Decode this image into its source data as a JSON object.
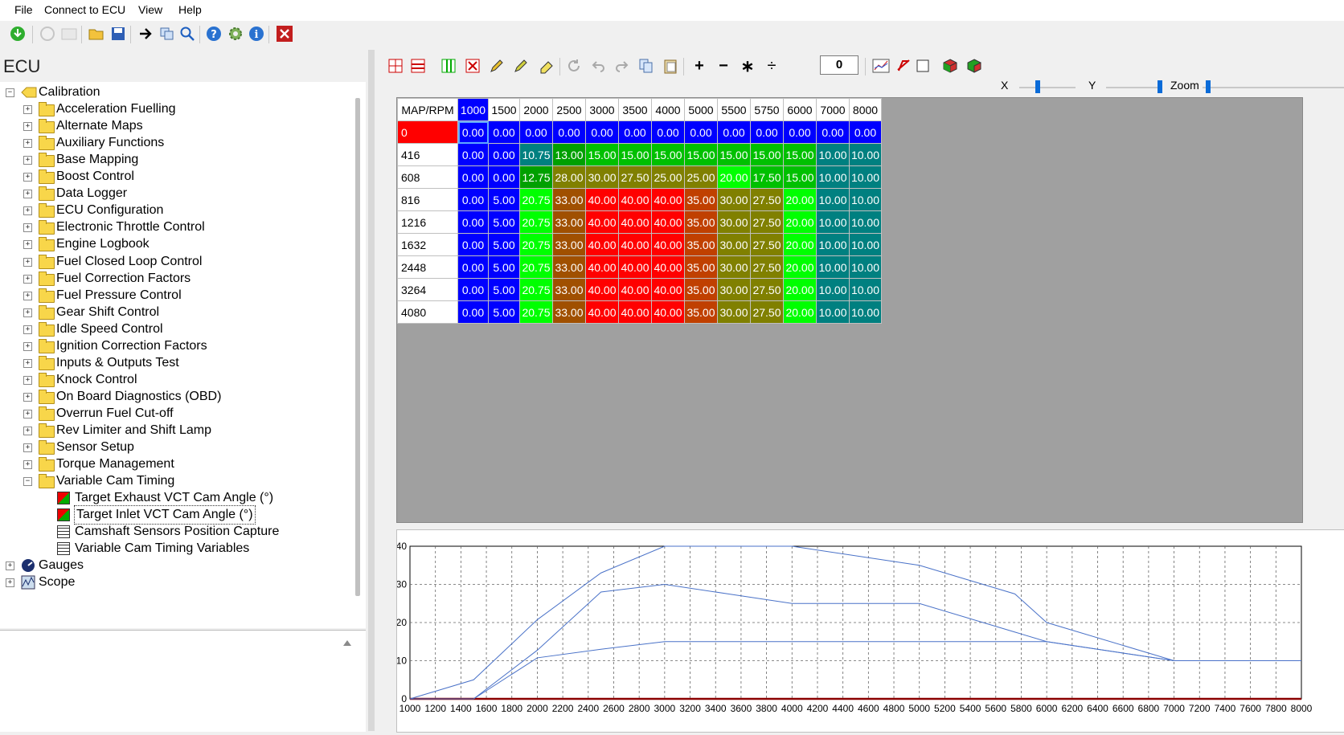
{
  "menu": [
    "File",
    "Connect to ECU",
    "View",
    "Help"
  ],
  "left": {
    "title": "ECU",
    "tree": [
      {
        "label": "Calibration",
        "level": 0,
        "icon": "calibration-icon",
        "expanded": true
      },
      {
        "label": "Acceleration Fuelling",
        "level": 1,
        "icon": "folder-icon"
      },
      {
        "label": "Alternate Maps",
        "level": 1,
        "icon": "folder-icon"
      },
      {
        "label": "Auxiliary Functions",
        "level": 1,
        "icon": "folder-icon"
      },
      {
        "label": "Base Mapping",
        "level": 1,
        "icon": "folder-icon"
      },
      {
        "label": "Boost Control",
        "level": 1,
        "icon": "folder-icon"
      },
      {
        "label": "Data Logger",
        "level": 1,
        "icon": "folder-icon"
      },
      {
        "label": "ECU Configuration",
        "level": 1,
        "icon": "folder-icon"
      },
      {
        "label": "Electronic Throttle Control",
        "level": 1,
        "icon": "folder-icon"
      },
      {
        "label": "Engine Logbook",
        "level": 1,
        "icon": "folder-icon"
      },
      {
        "label": "Fuel Closed Loop Control",
        "level": 1,
        "icon": "folder-icon"
      },
      {
        "label": "Fuel Correction Factors",
        "level": 1,
        "icon": "folder-icon"
      },
      {
        "label": "Fuel Pressure Control",
        "level": 1,
        "icon": "folder-icon"
      },
      {
        "label": "Gear Shift Control",
        "level": 1,
        "icon": "folder-icon"
      },
      {
        "label": "Idle Speed Control",
        "level": 1,
        "icon": "folder-icon"
      },
      {
        "label": "Ignition Correction Factors",
        "level": 1,
        "icon": "folder-icon"
      },
      {
        "label": "Inputs & Outputs Test",
        "level": 1,
        "icon": "folder-icon"
      },
      {
        "label": "Knock Control",
        "level": 1,
        "icon": "folder-icon"
      },
      {
        "label": "On Board Diagnostics (OBD)",
        "level": 1,
        "icon": "folder-icon"
      },
      {
        "label": "Overrun Fuel Cut-off",
        "level": 1,
        "icon": "folder-icon"
      },
      {
        "label": "Rev Limiter and Shift Lamp",
        "level": 1,
        "icon": "folder-icon"
      },
      {
        "label": "Sensor Setup",
        "level": 1,
        "icon": "folder-icon"
      },
      {
        "label": "Torque Management",
        "level": 1,
        "icon": "folder-icon"
      },
      {
        "label": "Variable Cam Timing",
        "level": 1,
        "icon": "folder-icon",
        "expanded": true
      },
      {
        "label": "Target Exhaust VCT Cam Angle (°)",
        "level": 2,
        "icon": "map-cube-icon"
      },
      {
        "label": "Target Inlet VCT Cam Angle (°)",
        "level": 2,
        "icon": "map-cube-icon",
        "selected": true
      },
      {
        "label": "Camshaft Sensors Position Capture",
        "level": 2,
        "icon": "grid-icon"
      },
      {
        "label": "Variable Cam Timing Variables",
        "level": 2,
        "icon": "grid-icon"
      },
      {
        "label": "Gauges",
        "level": 0,
        "icon": "gauges-icon"
      },
      {
        "label": "Scope",
        "level": 0,
        "icon": "scope-icon"
      }
    ]
  },
  "toolbar_value": "0",
  "sliders": {
    "x": "X",
    "y": "Y",
    "zoom": "Zoom"
  },
  "table": {
    "corner": "MAP/RPM",
    "columns": [
      "1000",
      "1500",
      "2000",
      "2500",
      "3000",
      "3500",
      "4000",
      "5000",
      "5500",
      "5750",
      "6000",
      "7000",
      "8000"
    ],
    "rows": [
      {
        "map": "0",
        "values": [
          "0.00",
          "0.00",
          "0.00",
          "0.00",
          "0.00",
          "0.00",
          "0.00",
          "0.00",
          "0.00",
          "0.00",
          "0.00",
          "0.00",
          "0.00"
        ]
      },
      {
        "map": "416",
        "values": [
          "0.00",
          "0.00",
          "10.75",
          "13.00",
          "15.00",
          "15.00",
          "15.00",
          "15.00",
          "15.00",
          "15.00",
          "15.00",
          "10.00",
          "10.00"
        ]
      },
      {
        "map": "608",
        "values": [
          "0.00",
          "0.00",
          "12.75",
          "28.00",
          "30.00",
          "27.50",
          "25.00",
          "25.00",
          "20.00",
          "17.50",
          "15.00",
          "10.00",
          "10.00"
        ]
      },
      {
        "map": "816",
        "values": [
          "0.00",
          "5.00",
          "20.75",
          "33.00",
          "40.00",
          "40.00",
          "40.00",
          "35.00",
          "30.00",
          "27.50",
          "20.00",
          "10.00",
          "10.00"
        ]
      },
      {
        "map": "1216",
        "values": [
          "0.00",
          "5.00",
          "20.75",
          "33.00",
          "40.00",
          "40.00",
          "40.00",
          "35.00",
          "30.00",
          "27.50",
          "20.00",
          "10.00",
          "10.00"
        ]
      },
      {
        "map": "1632",
        "values": [
          "0.00",
          "5.00",
          "20.75",
          "33.00",
          "40.00",
          "40.00",
          "40.00",
          "35.00",
          "30.00",
          "27.50",
          "20.00",
          "10.00",
          "10.00"
        ]
      },
      {
        "map": "2448",
        "values": [
          "0.00",
          "5.00",
          "20.75",
          "33.00",
          "40.00",
          "40.00",
          "40.00",
          "35.00",
          "30.00",
          "27.50",
          "20.00",
          "10.00",
          "10.00"
        ]
      },
      {
        "map": "3264",
        "values": [
          "0.00",
          "5.00",
          "20.75",
          "33.00",
          "40.00",
          "40.00",
          "40.00",
          "35.00",
          "30.00",
          "27.50",
          "20.00",
          "10.00",
          "10.00"
        ]
      },
      {
        "map": "4080",
        "values": [
          "0.00",
          "5.00",
          "20.75",
          "33.00",
          "40.00",
          "40.00",
          "40.00",
          "35.00",
          "30.00",
          "27.50",
          "20.00",
          "10.00",
          "10.00"
        ]
      }
    ]
  },
  "chart_data": {
    "type": "line",
    "title": "",
    "xlabel": "",
    "ylabel": "",
    "xlim": [
      1000,
      8000
    ],
    "ylim": [
      0,
      40
    ],
    "grid": true,
    "x": [
      1000,
      1500,
      2000,
      2500,
      3000,
      3500,
      4000,
      5000,
      5500,
      5750,
      6000,
      7000,
      8000
    ],
    "xticks": [
      1000,
      1200,
      1400,
      1600,
      1800,
      2000,
      2200,
      2400,
      2600,
      2800,
      3000,
      3200,
      3400,
      3600,
      3800,
      4000,
      4200,
      4400,
      4600,
      4800,
      5000,
      5200,
      5400,
      5600,
      5800,
      6000,
      6200,
      6400,
      6600,
      6800,
      7000,
      7200,
      7400,
      7600,
      7800,
      8000
    ],
    "yticks": [
      0,
      10,
      20,
      30,
      40
    ],
    "series": [
      {
        "values": [
          0,
          0,
          0,
          0,
          0,
          0,
          0,
          0,
          0,
          0,
          0,
          0,
          0
        ],
        "color": "#8b0000"
      },
      {
        "values": [
          0,
          0,
          10.75,
          13,
          15,
          15,
          15,
          15,
          15,
          15,
          15,
          10,
          10
        ],
        "color": "#4a72c8"
      },
      {
        "values": [
          0,
          0,
          12.75,
          28,
          30,
          27.5,
          25,
          25,
          20,
          17.5,
          15,
          10,
          10
        ],
        "color": "#4a72c8"
      },
      {
        "values": [
          0,
          5,
          20.75,
          33,
          40,
          40,
          40,
          35,
          30,
          27.5,
          20,
          10,
          10
        ],
        "color": "#4a72c8"
      }
    ]
  }
}
